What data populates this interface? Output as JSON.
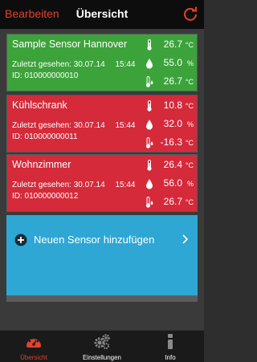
{
  "navbar": {
    "edit_label": "Bearbeiten",
    "title": "Übersicht",
    "refresh_icon": "refresh-icon"
  },
  "colors": {
    "ok": "#3ca33b",
    "alert": "#d42a3a",
    "add": "#2ea7d4",
    "accent": "#e0432c"
  },
  "sensors": [
    {
      "name": "Sample Sensor Hannover",
      "status": "ok",
      "last_seen_label": "Zuletzt gesehen:",
      "last_seen_date": "30.07.14",
      "last_seen_time": "15:44",
      "id": "ID: 010000000010",
      "temperature": "26.7",
      "temperature_unit": "°C",
      "humidity": "55.0",
      "humidity_unit": "%",
      "dewpoint": "26.7",
      "dewpoint_unit": "°C"
    },
    {
      "name": "Kühlschrank",
      "status": "alert",
      "last_seen_label": "Zuletzt gesehen:",
      "last_seen_date": "30.07.14",
      "last_seen_time": "15:44",
      "id": "ID: 010000000011",
      "temperature": "10.8",
      "temperature_unit": "°C",
      "humidity": "32.0",
      "humidity_unit": "%",
      "dewpoint": "-16.3",
      "dewpoint_unit": "°C"
    },
    {
      "name": "Wohnzimmer",
      "status": "alert",
      "last_seen_label": "Zuletzt gesehen:",
      "last_seen_date": "30.07.14",
      "last_seen_time": "15:44",
      "id": "ID: 010000000012",
      "temperature": "26.4",
      "temperature_unit": "°C",
      "humidity": "56.0",
      "humidity_unit": "%",
      "dewpoint": "26.7",
      "dewpoint_unit": "°C"
    }
  ],
  "add_sensor": {
    "label": "Neuen Sensor hinzufügen"
  },
  "tabs": [
    {
      "label": "Übersicht",
      "icon": "overview-icon",
      "active": true
    },
    {
      "label": "Einstellungen",
      "icon": "gears-icon",
      "active": false
    },
    {
      "label": "Info",
      "icon": "info-icon",
      "active": false
    }
  ]
}
